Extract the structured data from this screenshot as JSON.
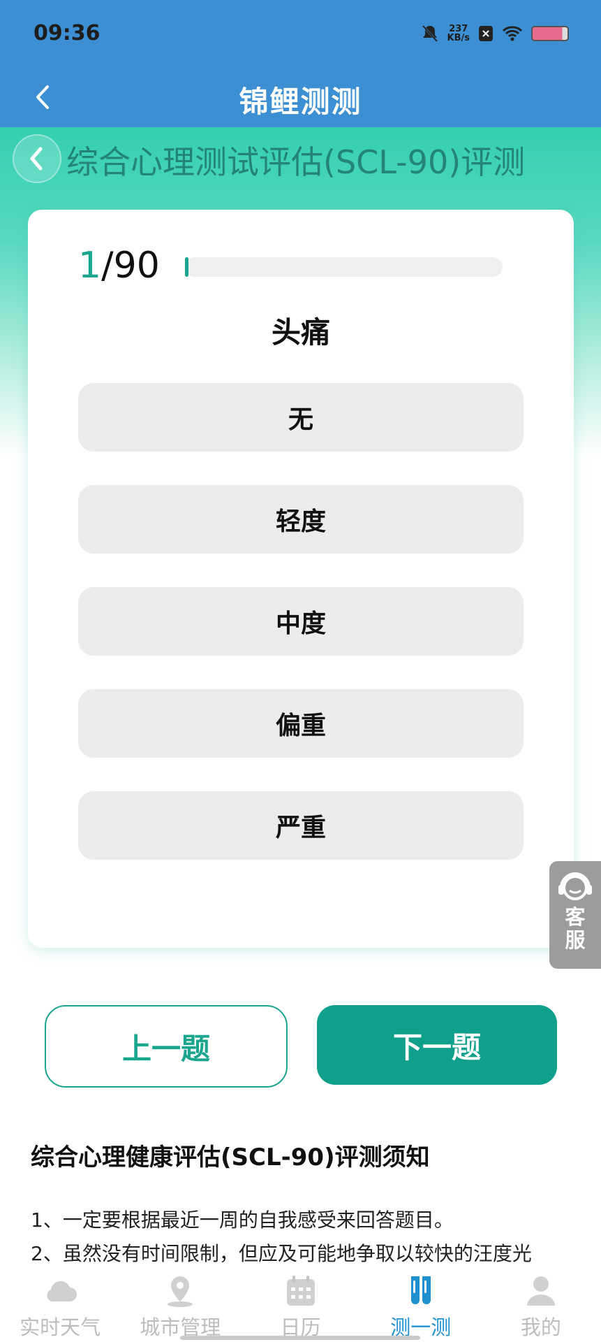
{
  "status_bar": {
    "time": "09:36",
    "net_speed_value": "237",
    "net_speed_unit": "KB/s"
  },
  "app_bar": {
    "title": "锦鲤测测"
  },
  "page": {
    "heading": "综合心理测试评估(SCL-90)评测"
  },
  "quiz": {
    "current": "1",
    "total_suffix": "/90",
    "progress_fraction": 0.011,
    "question": "头痛",
    "options": [
      "无",
      "轻度",
      "中度",
      "偏重",
      "严重"
    ]
  },
  "customer_service": {
    "label": "客服"
  },
  "buttons": {
    "prev": "上一题",
    "next": "下一题"
  },
  "notice": {
    "title": "综合心理健康评估(SCL-90)评测须知",
    "lines": [
      "1、一定要根据最近一周的自我感受来回答题目。",
      "2、虽然没有时间限制，但应及可能地争取以较快的汪度光"
    ]
  },
  "tabbar": {
    "items": [
      {
        "label": "实时天气",
        "icon": "cloud-icon",
        "active": false
      },
      {
        "label": "城市管理",
        "icon": "location-pin-icon",
        "active": false
      },
      {
        "label": "日历",
        "icon": "calendar-icon",
        "active": false
      },
      {
        "label": "测一测",
        "icon": "test-tubes-icon",
        "active": true
      },
      {
        "label": "我的",
        "icon": "person-icon",
        "active": false
      }
    ]
  },
  "colors": {
    "header_blue": "#3b8fd2",
    "accent_teal": "#0fa08c",
    "tab_active": "#1f8fd0",
    "tab_inactive": "#bdbdbd"
  }
}
